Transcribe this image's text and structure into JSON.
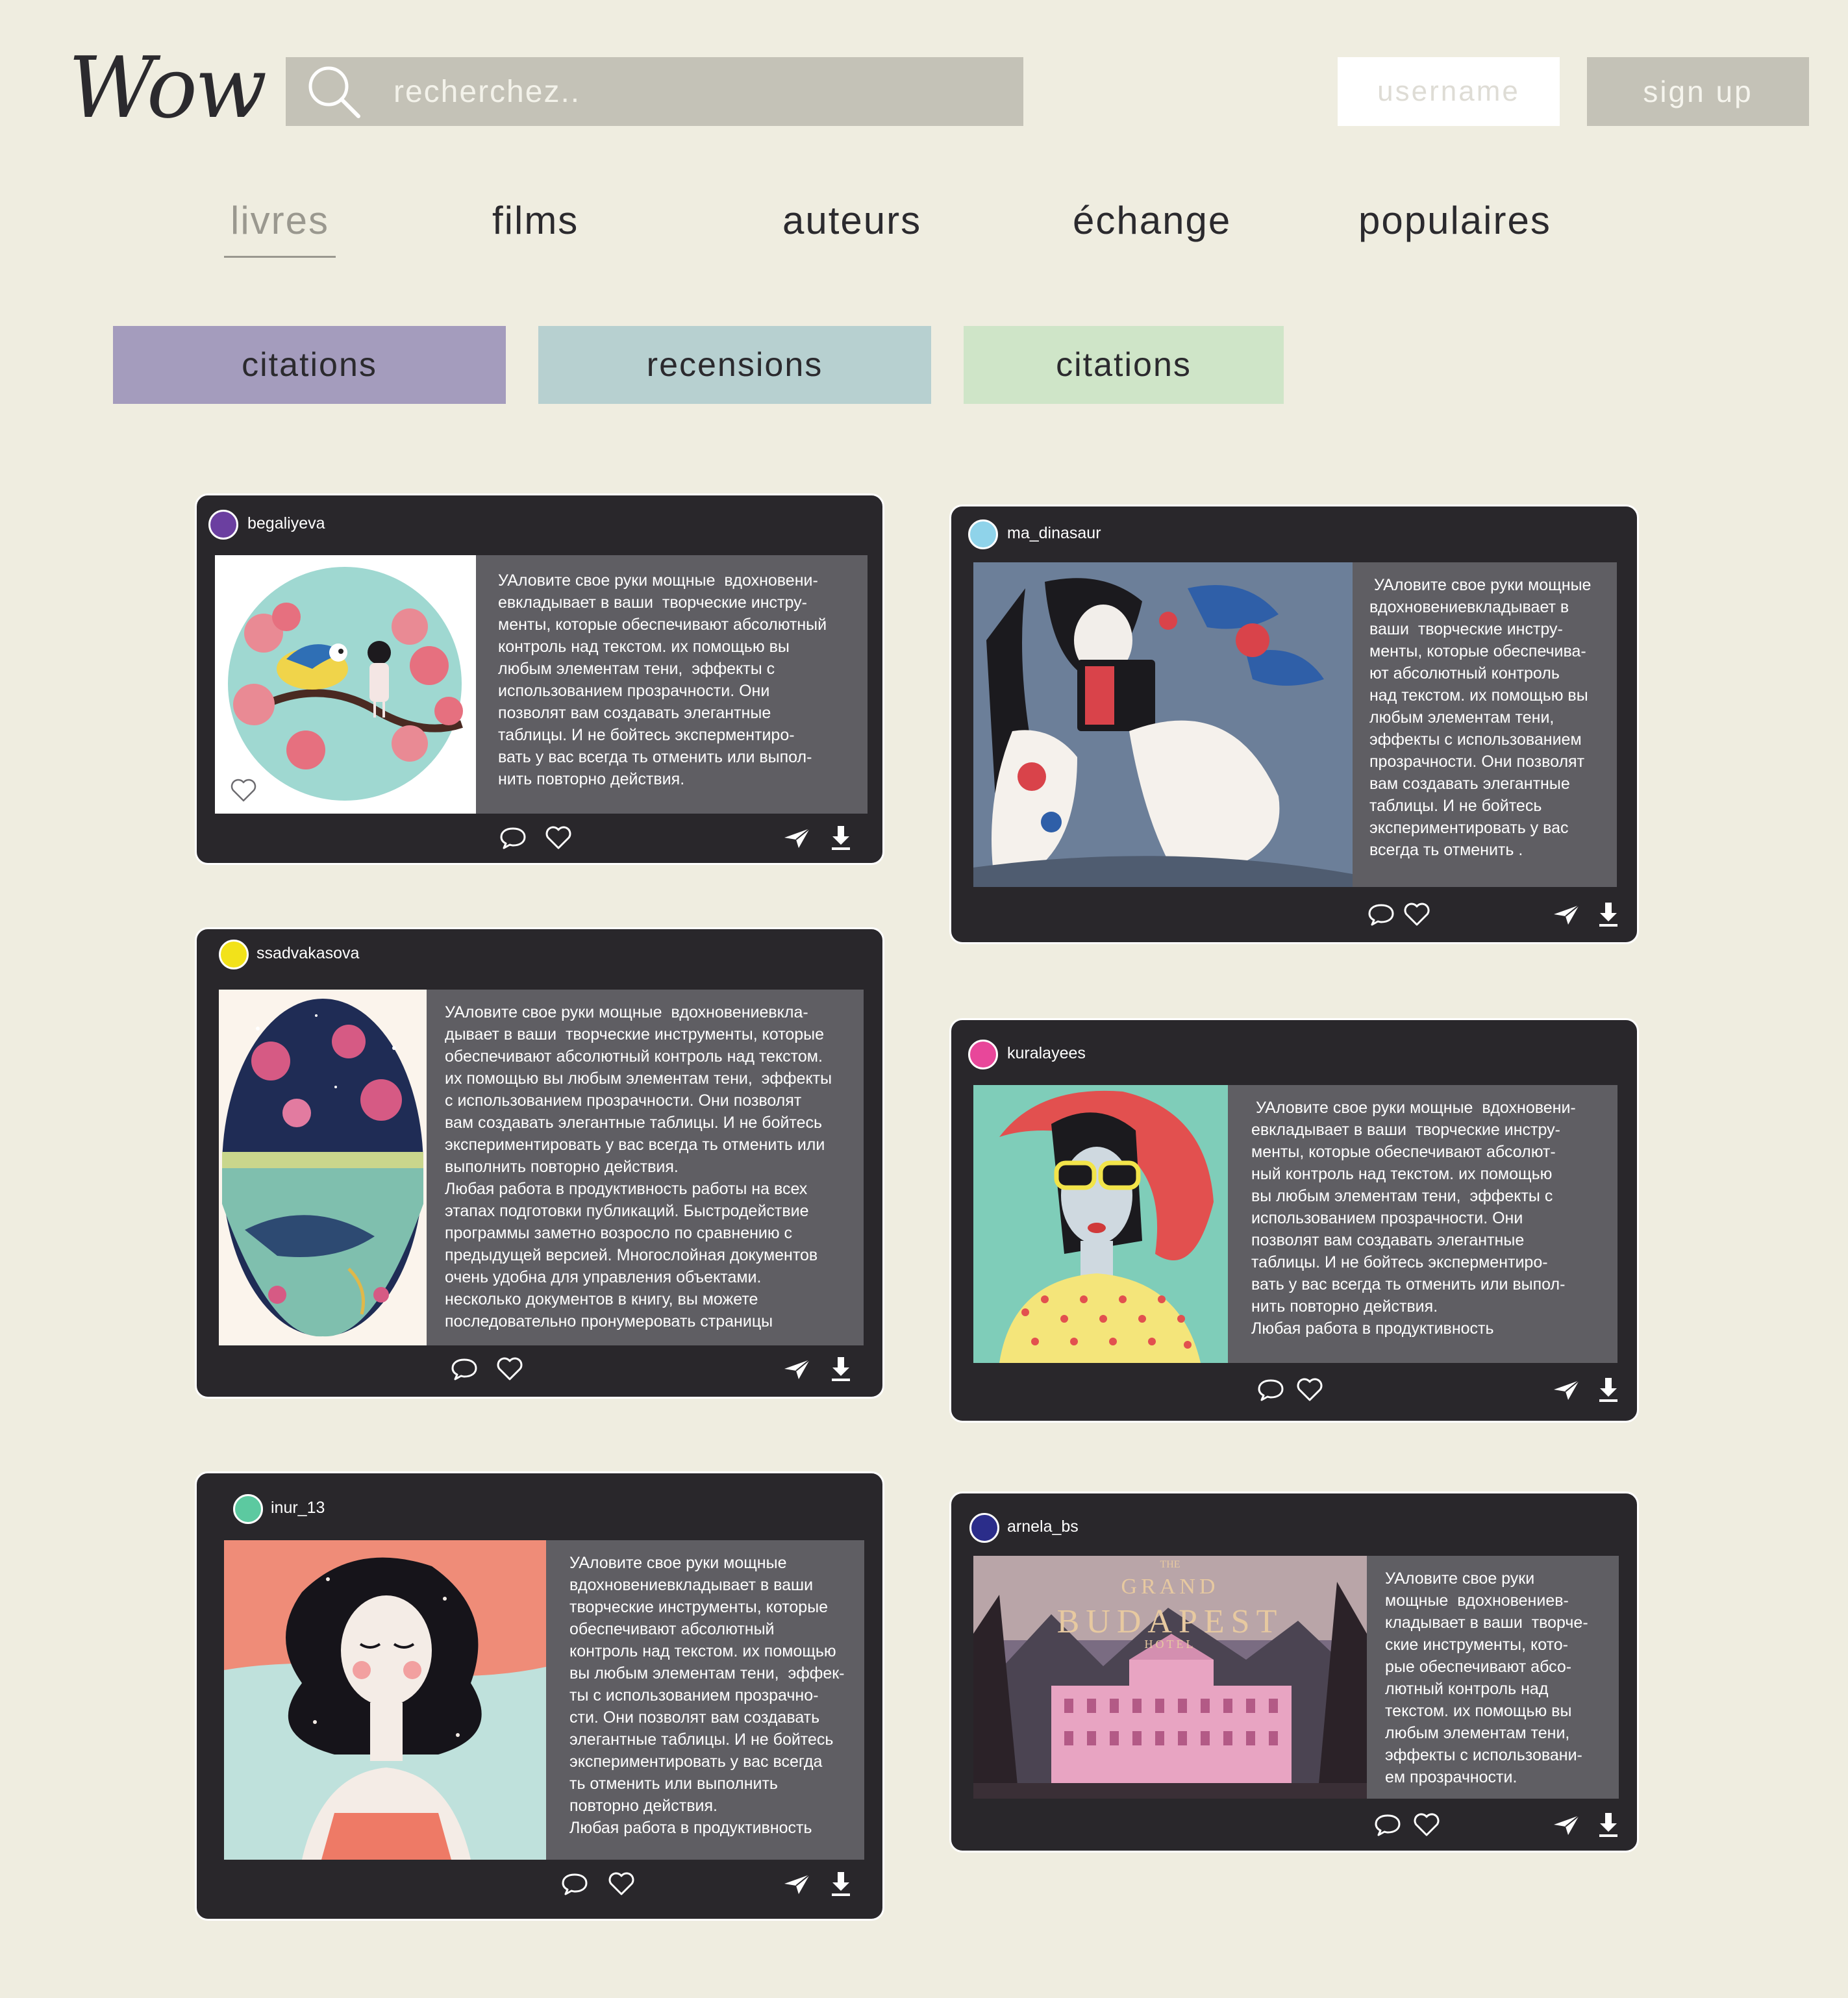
{
  "header": {
    "logo": "Wow",
    "search_placeholder": "recherchez..",
    "username_placeholder": "username",
    "signup_label": "sign up"
  },
  "nav": [
    {
      "label": "livres",
      "active": true
    },
    {
      "label": "films",
      "active": false
    },
    {
      "label": "auteurs",
      "active": false
    },
    {
      "label": "échange",
      "active": false
    },
    {
      "label": "populaires",
      "active": false
    }
  ],
  "categories": [
    {
      "label": "citations",
      "color": "#a49cbd"
    },
    {
      "label": "recensions",
      "color": "#b7d0d0"
    },
    {
      "label": "citations",
      "color": "#cfe5c8"
    }
  ],
  "posts": [
    {
      "user": "begaliyeva",
      "avatar_color": "#6b3fa0",
      "image": "bird-and-girl-on-blossom-branch",
      "text": "УАловите свое руки мощные  вдохновени-\nевкладывает в ваши  творческие инстру-\nменты, которые обеспечивают абсолютный\nконтроль над текстом. их помощью вы\nлюбым элементам тени,  эффекты с\nиспользованием прозрачности. Они\nпозволят вам создавать элегантные\nтаблицы. И не бойтесь эксперментиро-\nвать у вас всегда ть отменить или выпол-\nнить повторно действия."
    },
    {
      "user": "ma_dinasaur",
      "avatar_color": "#8fd3ea",
      "image": "woman-reading-book-with-flowers",
      "text": " УАловите свое руки мощные\nвдохновениевкладывает в\nваши  творческие инстру-\nменты, которые обеспечива-\nют абсолютный контроль\nнад текстом. их помощью вы\nлюбым элементам тени,\nэффекты с использованием\nпрозрачности. Они позволят\nвам создавать элегантные\nтаблицы. И не бойтесь\nэкспериментировать у вас\nвсегда ть отменить ."
    },
    {
      "user": "ssadvakasova",
      "avatar_color": "#f2e21a",
      "image": "whale-under-night-sky",
      "text": "УАловите свое руки мощные  вдохновениевкла-\nдывает в ваши  творческие инструменты, которые\nобеспечивают абсолютный контроль над текстом.\nих помощью вы любым элементам тени,  эффекты\nс использованием прозрачности. Они позволят\nвам создавать элегантные таблицы. И не бойтесь\nэкспериментировать у вас всегда ть отменить или\nвыполнить повторно действия.\nЛюбая работа в продуктивность работы на всех\nэтапах подготовки публикаций. Быстродействие\nпрограммы заметно возросло по сравнению с\nпредыдущей версией. Многослойная документов\nочень удобна для управления объектами.\nнесколько документов в книгу, вы можете\nпоследовательно пронумеровать страницы"
    },
    {
      "user": "kuralayees",
      "avatar_color": "#e8479a",
      "image": "woman-in-red-hat-and-sunglasses",
      "text": " УАловите свое руки мощные  вдохновени-\nевкладывает в ваши  творческие инстру-\nменты, которые обеспечивают абсолют-\nный контроль над текстом. их помощью\nвы любым элементам тени,  эффекты с\nиспользованием прозрачности. Они\nпозволят вам создавать элегантные\nтаблицы. И не бойтесь эксперментиро-\nвать у вас всегда ть отменить или выпол-\nнить повторно действия.\nЛюбая работа в продуктивность"
    },
    {
      "user": "inur_13",
      "avatar_color": "#5cc9a0",
      "image": "girl-with-dark-hair-in-water",
      "text": "УАловите свое руки мощные\nвдохновениевкладывает в ваши\nтворческие инструменты, которые\nобеспечивают абсолютный\nконтроль над текстом. их помощью\nвы любым элементам тени,  эффек-\nты с использованием прозрачно-\nсти. Они позволят вам создавать\nэлегантные таблицы. И не бойтесь\nэкспериментировать у вас всегда\nть отменить или выполнить\nповторно действия.\nЛюбая работа в продуктивность"
    },
    {
      "user": "arnela_bs",
      "avatar_color": "#2b2d8a",
      "image": "grand-budapest-hotel-poster",
      "text": "УАловите свое руки\nмощные  вдохновениев-\nкладывает в ваши  творче-\nские инструменты, кото-\nрые обеспечивают абсо-\nлютный контроль над\nтекстом. их помощью вы\nлюбым элементам тени,\nэффекты с использовани-\nем прозрачности."
    }
  ],
  "poster": {
    "line1": "THE",
    "line2": "GRAND",
    "line3": "BUDAPEST",
    "line4": "HOTEL"
  },
  "icons": {
    "comment": "comment-icon",
    "like": "heart-icon",
    "share": "send-icon",
    "download": "download-icon"
  }
}
